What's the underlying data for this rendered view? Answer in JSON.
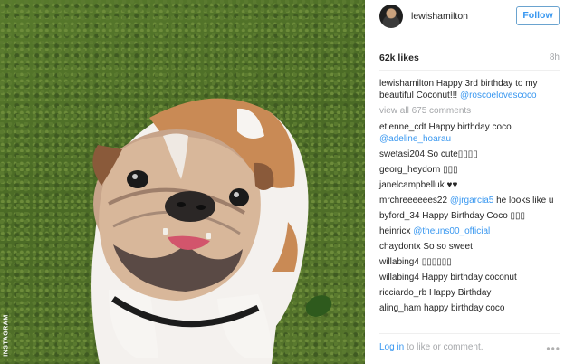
{
  "photo": {
    "credit": "INSTAGRAM"
  },
  "header": {
    "username": "lewishamilton",
    "follow_label": "Follow"
  },
  "stats": {
    "likes": "62k likes",
    "time": "8h"
  },
  "caption": {
    "user": "lewishamilton",
    "text": "Happy 3rd birthday to my beautiful Coconut!!! ",
    "mention": "@roscoelovescoco"
  },
  "view_all": "view all 675 comments",
  "comments": [
    {
      "user": "etienne_cdt",
      "text": "Happy birthday coco ",
      "mention": "@adeline_hoarau"
    },
    {
      "user": "swetasi204",
      "text": "So cute▯▯▯▯",
      "mention": ""
    },
    {
      "user": "georg_heydorn",
      "text": "▯▯▯",
      "mention": ""
    },
    {
      "user": "janelcampbelluk",
      "text": "♥♥",
      "mention": ""
    },
    {
      "user": "mrchreeeeees22",
      "text": "he looks like u",
      "mention": "@jrgarcia5"
    },
    {
      "user": "byford_34",
      "text": "Happy Birthday Coco ▯▯▯",
      "mention": ""
    },
    {
      "user": "heinricx",
      "text": "",
      "mention": "@theuns00_official"
    },
    {
      "user": "chaydontx",
      "text": "So so sweet",
      "mention": ""
    },
    {
      "user": "willabing4",
      "text": "▯▯▯▯▯▯",
      "mention": ""
    },
    {
      "user": "willabing4",
      "text": "Happy birthday coconut",
      "mention": ""
    },
    {
      "user": "ricciardo_rb",
      "text": "Happy Birthday",
      "mention": ""
    },
    {
      "user": "aling_ham",
      "text": "happy birthday coco",
      "mention": ""
    }
  ],
  "footer": {
    "login_link": "Log in",
    "login_text": " to like or comment.",
    "more_icon": "ellipsis-icon"
  },
  "colors": {
    "accent": "#3897f0",
    "muted": "#a5a7aa",
    "text": "#262626"
  }
}
